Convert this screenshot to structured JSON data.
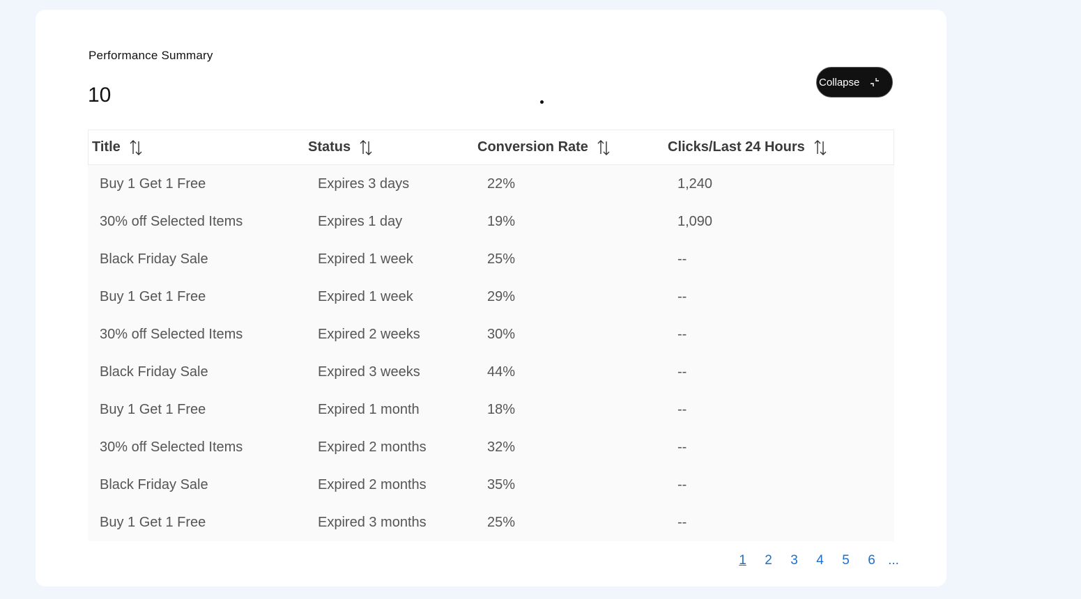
{
  "summary": {
    "label": "Performance Summary",
    "count": "10"
  },
  "collapse_button": {
    "label": "Collapse"
  },
  "table": {
    "columns": [
      "Title",
      "Status",
      "Conversion Rate",
      "Clicks/Last 24 Hours"
    ],
    "rows": [
      [
        "Buy 1 Get 1 Free",
        "Expires 3 days",
        "22%",
        "1,240"
      ],
      [
        "30% off Selected Items",
        "Expires 1 day",
        "19%",
        "1,090"
      ],
      [
        "Black Friday Sale",
        "Expired 1 week",
        "25%",
        "--"
      ],
      [
        "Buy 1 Get 1 Free",
        "Expired 1 week",
        "29%",
        "--"
      ],
      [
        "30% off Selected Items",
        "Expired 2 weeks",
        "30%",
        "--"
      ],
      [
        "Black Friday Sale",
        "Expired 3 weeks",
        "44%",
        "--"
      ],
      [
        "Buy 1 Get 1 Free",
        "Expired 1 month",
        "18%",
        "--"
      ],
      [
        "30% off Selected Items",
        "Expired 2 months",
        "32%",
        "--"
      ],
      [
        "Black Friday Sale",
        "Expired 2 months",
        "35%",
        "--"
      ],
      [
        "Buy 1 Get 1 Free",
        "Expired 3 months",
        "25%",
        "--"
      ]
    ]
  },
  "pagination": {
    "pages": [
      "1",
      "2",
      "3",
      "4",
      "5",
      "6"
    ],
    "current": "1",
    "more": "..."
  },
  "icons": {
    "sort": "sort-arrows-icon",
    "collapse": "collapse-arrows-icon"
  },
  "colors": {
    "link": "#1e6fc9",
    "button_bg": "#111111",
    "page_bg": "#f0f6fc",
    "row_bg": "#fafafa"
  }
}
